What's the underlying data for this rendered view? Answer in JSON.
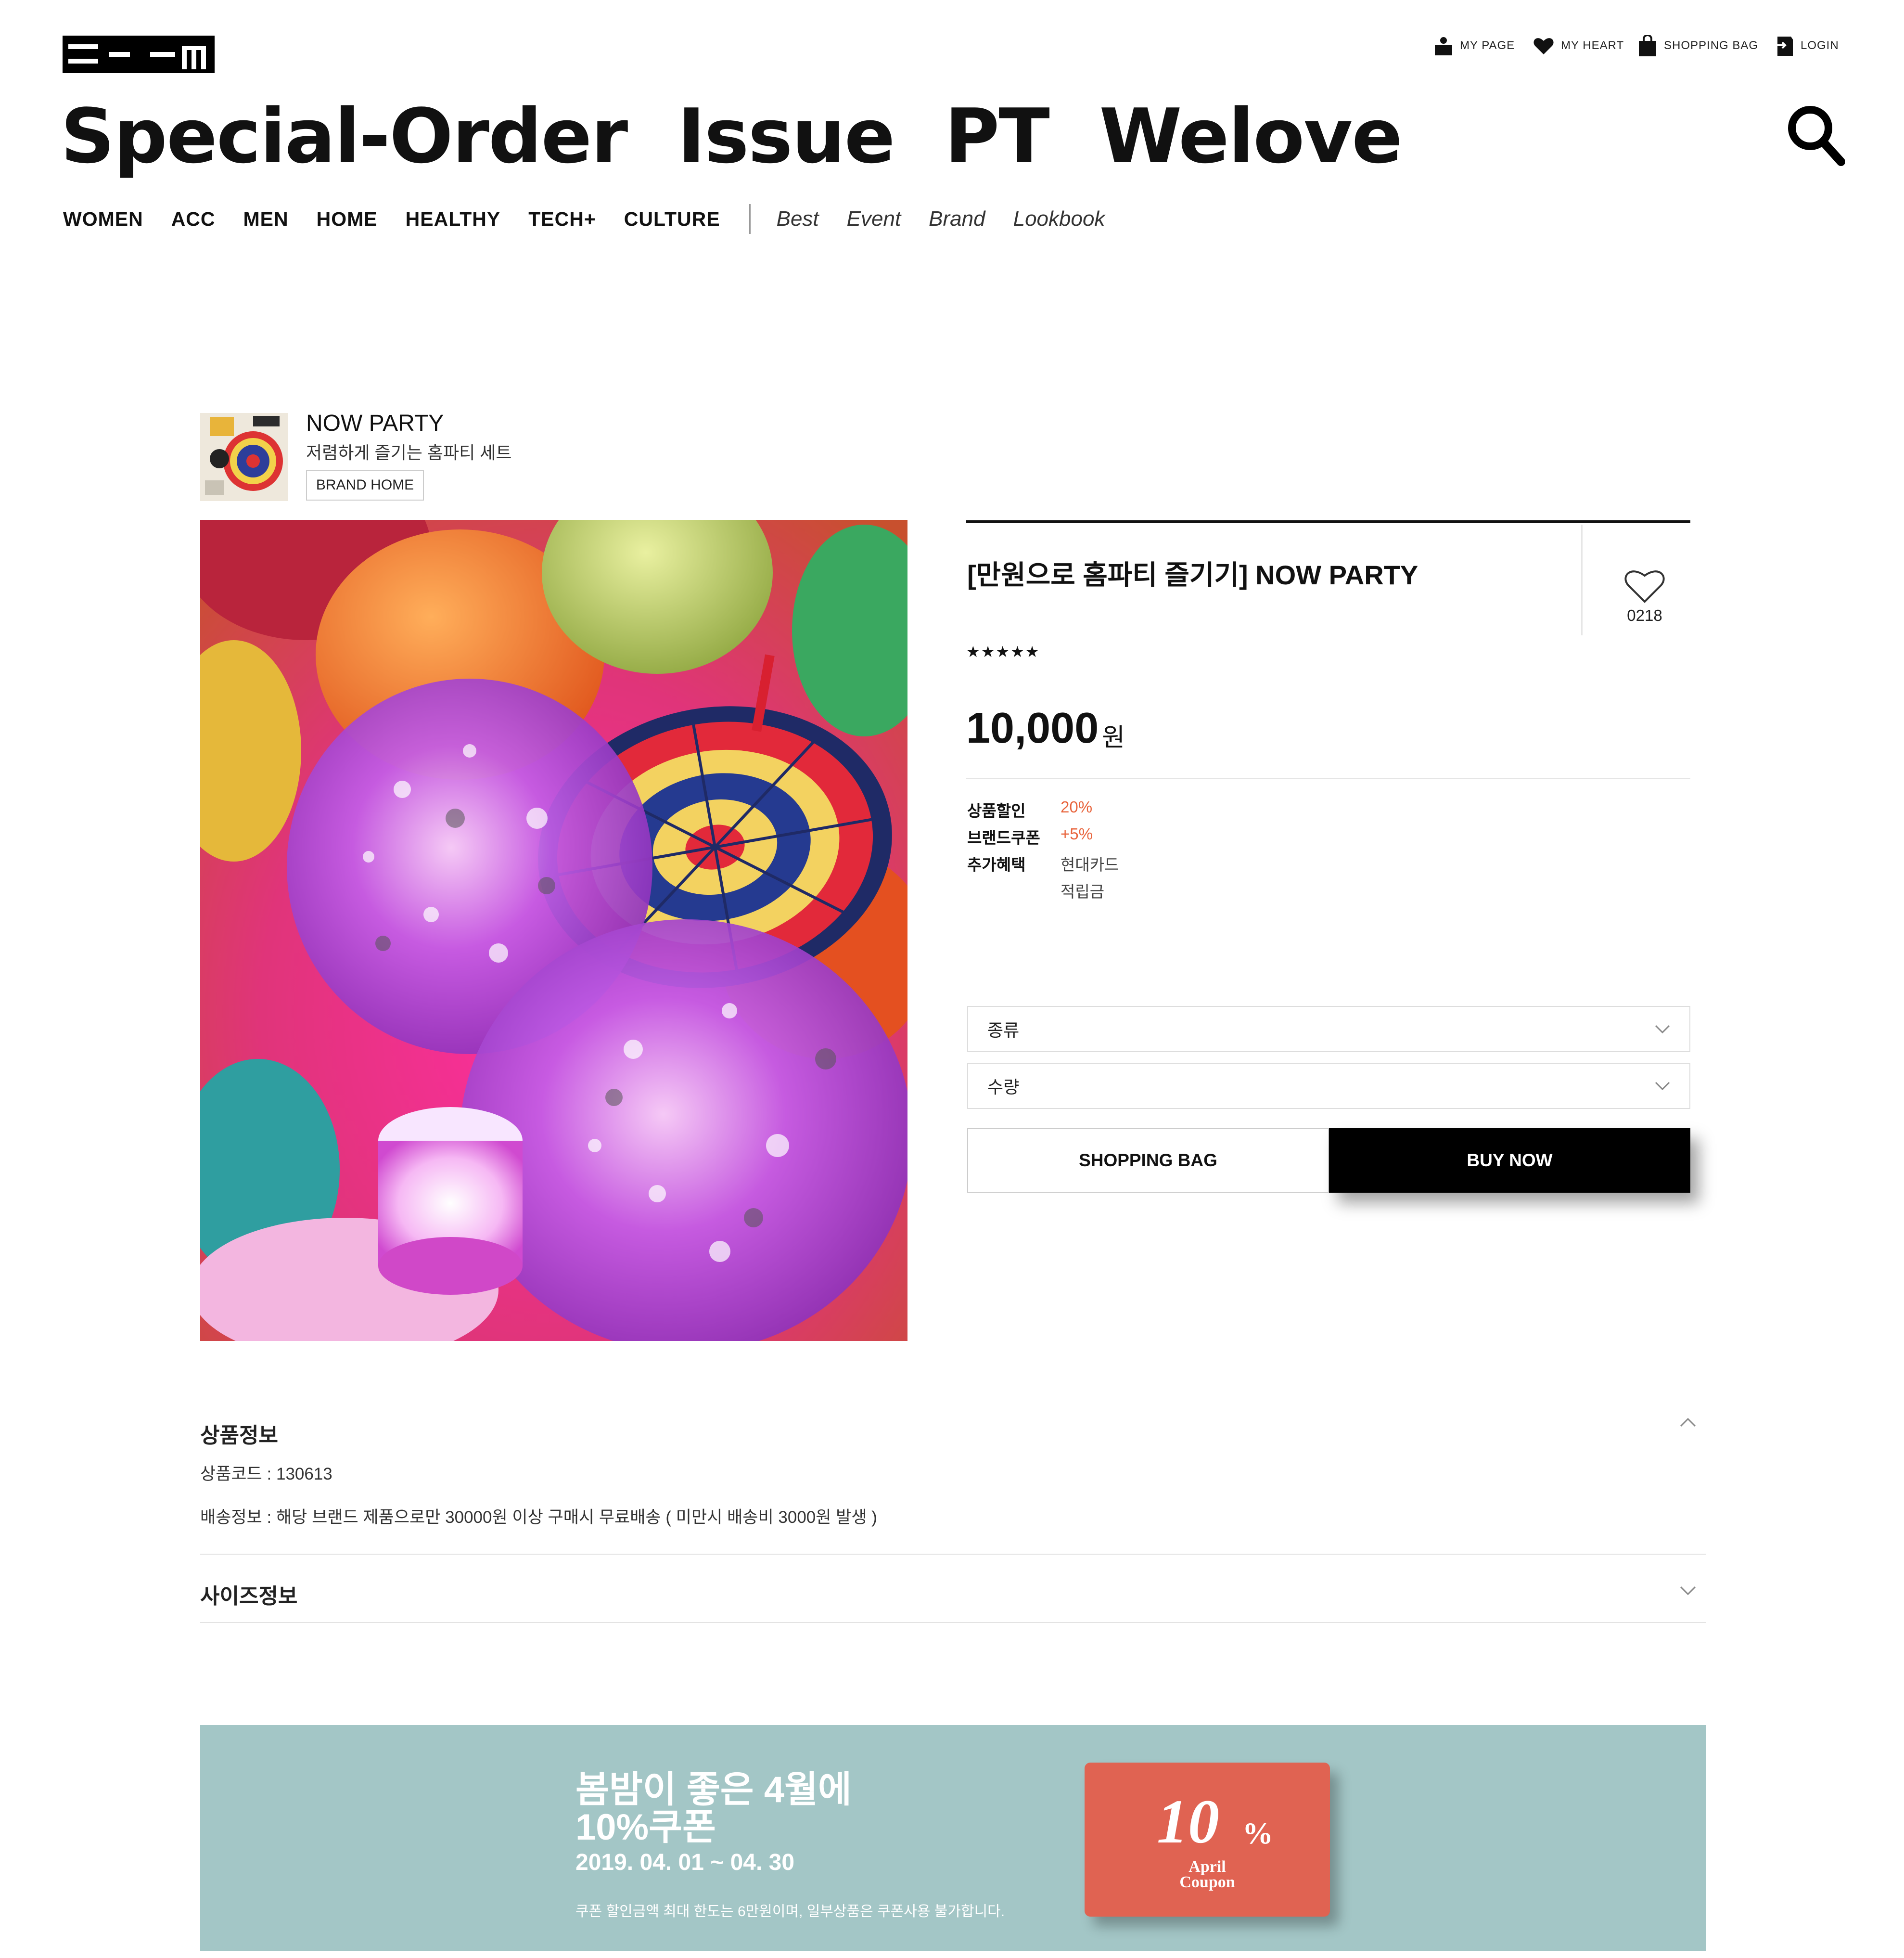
{
  "header": {
    "utility": [
      {
        "label": "MY PAGE",
        "icon": "user-icon"
      },
      {
        "label": "MY HEART",
        "icon": "heart-icon"
      },
      {
        "label": "SHOPPING BAG",
        "icon": "shopping-bag-icon"
      },
      {
        "label": "LOGIN",
        "icon": "login-icon"
      }
    ],
    "title": "Special-Order  Issue  PT  Welove",
    "search_icon": "search-icon",
    "menu": [
      "WOMEN",
      "ACC",
      "MEN",
      "HOME",
      "HEALTHY",
      "TECH+",
      "CULTURE"
    ],
    "submenu": [
      "Best",
      "Event",
      "Brand",
      "Lookbook"
    ]
  },
  "brand": {
    "name": "NOW PARTY",
    "tagline": "저렴하게 즐기는 홈파티 세트",
    "home_button": "BRAND HOME"
  },
  "product": {
    "title": "[만원으로 홈파티 즐기기] NOW PARTY",
    "like_count": "0218",
    "rating_stars": "★★★★★",
    "price": "10,000",
    "price_unit": "원",
    "benefits": [
      {
        "label": "상품할인",
        "value": "20%"
      },
      {
        "label": "브랜드쿠폰",
        "value": "+5%"
      },
      {
        "label": "추가혜택",
        "value": "현대카드"
      },
      {
        "label": "",
        "value": "적립금"
      }
    ],
    "options": [
      {
        "placeholder": "종류"
      },
      {
        "placeholder": "수량"
      }
    ],
    "bag_button": "SHOPPING BAG",
    "buy_button": "BUY NOW"
  },
  "accordion": {
    "info_title": "상품정보",
    "product_code": "상품코드 : 130613",
    "shipping": "배송정보 : 해당 브랜드 제품으로만 30000원 이상 구매시 무료배송 ( 미만시 배송비 3000원 발생 )",
    "size_title": "사이즈정보"
  },
  "banner": {
    "headline1": "봄밤이 좋은 4월에",
    "headline2": "10%쿠폰",
    "date": "2019. 04. 01 ~ 04. 30",
    "note": "쿠폰 할인금액 최대 한도는 6만원이며, 일부상품은 쿠폰사용 불가합니다.",
    "coupon_number": "10",
    "coupon_percent": "%",
    "coupon_line1": "April",
    "coupon_line2": "Coupon"
  },
  "colors": {
    "accent_discount": "#e8643c",
    "banner_bg": "#a3c6c6",
    "coupon_bg": "#e06352",
    "buy_button_bg": "#000000"
  }
}
